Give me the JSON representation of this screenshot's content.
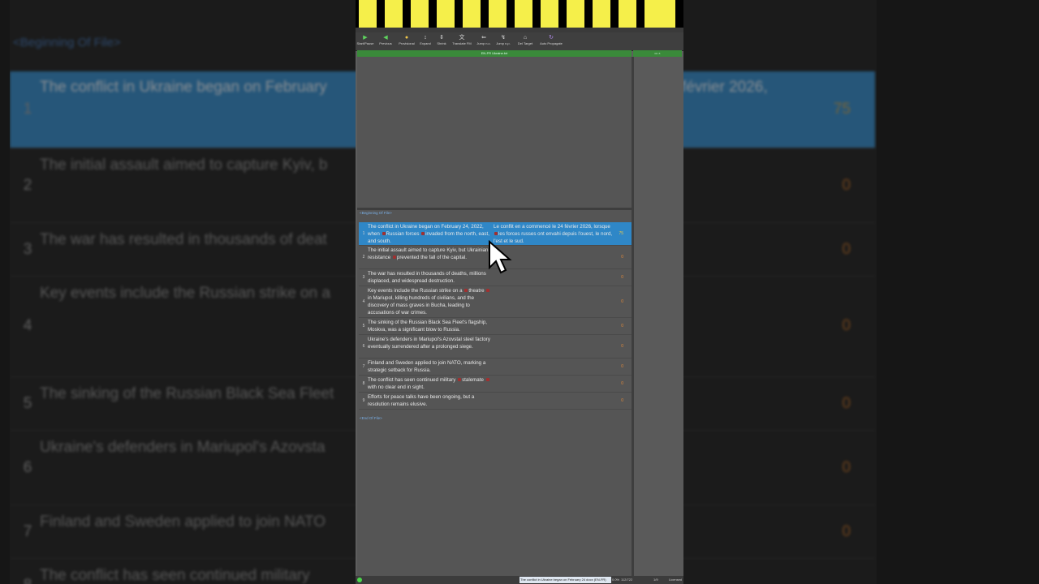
{
  "ribbon": [
    {
      "icon": "start-pause-icon",
      "label": "Start/Pause"
    },
    {
      "icon": "previous-icon",
      "label": "Previous"
    },
    {
      "icon": "provisional-icon",
      "label": "Provisional"
    },
    {
      "icon": "expand-icon",
      "label": "Expand"
    },
    {
      "icon": "shrink-icon",
      "label": "Shrink"
    },
    {
      "icon": "translate-icon",
      "label": "Translate FM"
    },
    {
      "icon": "jump-icon",
      "label": "Jump n.c."
    },
    {
      "icon": "jump-icon",
      "label": "Jump n.p."
    },
    {
      "icon": "del-target-icon",
      "label": "Del Target"
    },
    {
      "icon": "propagate-icon",
      "label": "Auto Propagate"
    }
  ],
  "header": {
    "tab": "EN-FR Ukraine.txt"
  },
  "editor": {
    "bof": "<Beginning Of File>",
    "eof": "<End Of File>",
    "segments": [
      {
        "num": "1",
        "src": "The conflict in Ukraine began on February 24, 2022, when [t] Russian forces [t] invaded from the north, east, and south.",
        "tgt": "Le conflit en a commencé le 24 février 2026, lorsque [t] les forces russes ont envahi depuis l'ouest, le nord, l'est et le sud.",
        "score": "75"
      },
      {
        "num": "2",
        "src": "The initial assault aimed to capture Kyiv, but Ukrainian resistance [t] prevented the fall of the capital.",
        "tgt": "",
        "score": "0"
      },
      {
        "num": "3",
        "src": "The war has resulted in thousands of deaths, millions displaced, and widespread destruction.",
        "tgt": "",
        "score": "0"
      },
      {
        "num": "4",
        "src": "Key events include the Russian strike on a [t] theatre [t] in Mariupol, killing hundreds of civilians, and the discovery of mass graves in Bucha, leading to accusations of war crimes.",
        "tgt": "",
        "score": "0"
      },
      {
        "num": "5",
        "src": "The sinking of the Russian Black Sea Fleet's flagship, Moskva, was a significant blow to Russia.",
        "tgt": "",
        "score": "0"
      },
      {
        "num": "6",
        "src": "Ukraine's defenders in Mariupol's Azovstal steel factory eventually surrendered after a prolonged siege.",
        "tgt": "",
        "score": "0"
      },
      {
        "num": "7",
        "src": "Finland and Sweden applied to join NATO, marking a strategic setback for Russia.",
        "tgt": "",
        "score": "0"
      },
      {
        "num": "8",
        "src": "The conflict has seen continued military [t] stalemate [t] with no clear end in sight.",
        "tgt": "",
        "score": "0"
      },
      {
        "num": "9",
        "src": "Efforts for peace talks have been ongoing, but a resolution remains elusive.",
        "tgt": "",
        "score": "0"
      }
    ]
  },
  "status": {
    "segment_text": "The conflict in Ukraine began on February 24 docx (EN-FR)",
    "percent": "0.0%",
    "words": "112/722",
    "pages": "1/9",
    "license": "Licensed"
  },
  "background": {
    "bof": "<Beginning Of File>",
    "rows": [
      {
        "num": "1",
        "src": "The conflict in Ukraine began on February",
        "tgt": "février 2026,",
        "score": "75"
      },
      {
        "num": "2",
        "src": "The initial assault aimed to capture Kyiv, b",
        "tgt": "",
        "score": "0"
      },
      {
        "num": "3",
        "src": "The war has resulted in thousands of deat",
        "tgt": "",
        "score": "0"
      },
      {
        "num": "4",
        "src": "Key events include the Russian strike on a",
        "tgt": "",
        "score": "0"
      },
      {
        "num": "5",
        "src": "The sinking of the Russian Black Sea Fleet",
        "tgt": "",
        "score": "0"
      },
      {
        "num": "6",
        "src": "Ukraine's defenders in Mariupol's Azovsta",
        "tgt": "",
        "score": "0"
      },
      {
        "num": "7",
        "src": "Finland and Sweden applied to join NATO",
        "tgt": "",
        "score": "0"
      },
      {
        "num": "8",
        "src": "The conflict has seen continued military",
        "tgt": "",
        "score": "0"
      }
    ]
  }
}
